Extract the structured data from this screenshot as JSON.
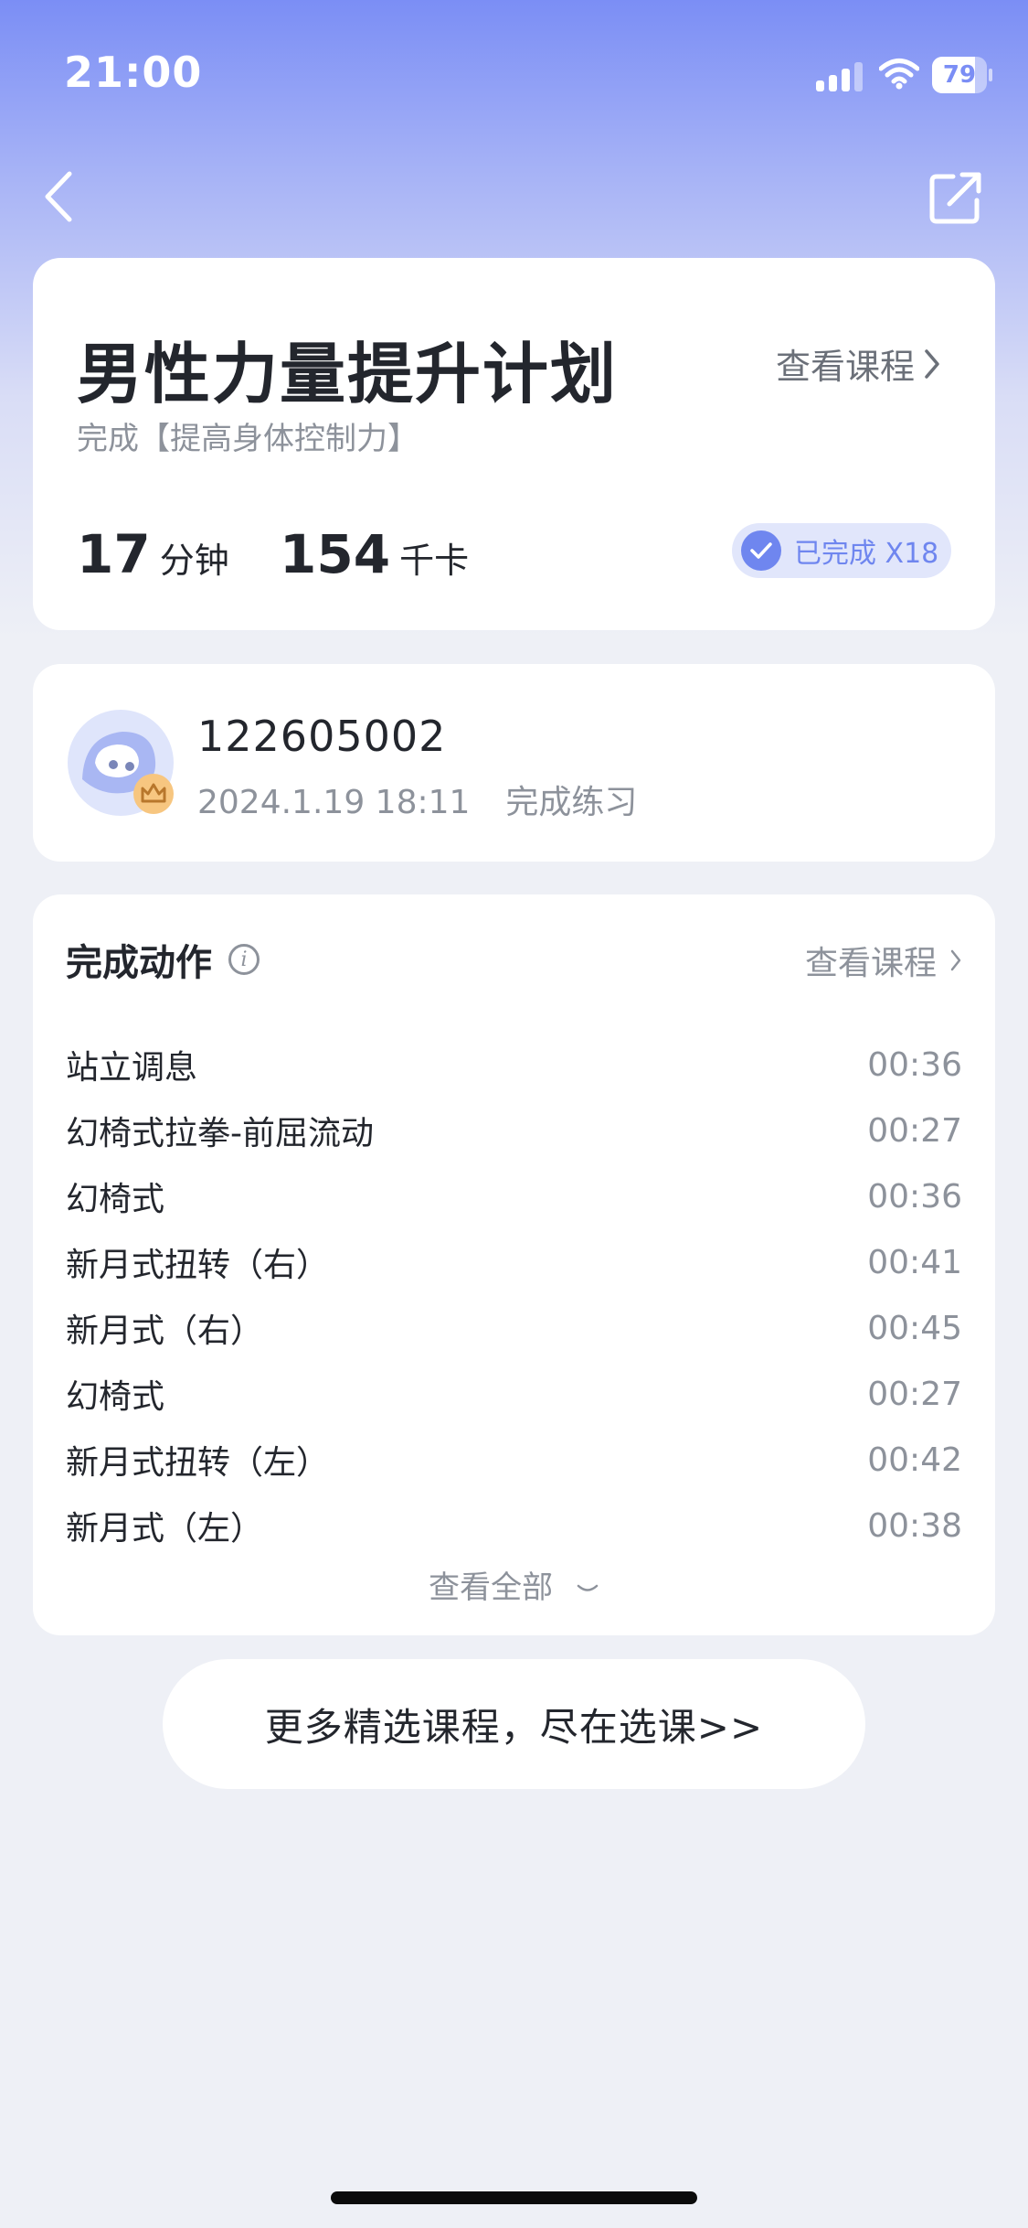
{
  "status_bar": {
    "time": "21:00",
    "battery": "79",
    "battery_level": 0.79,
    "icons": [
      "signal-icon",
      "wifi-icon",
      "battery-icon"
    ]
  },
  "nav": {
    "icons": [
      "back-arrow-icon",
      "share-icon"
    ]
  },
  "summary": {
    "title": "男性力量提升计划",
    "subtitle": "完成【提高身体控制力】",
    "view_course": "查看课程",
    "minutes_value": "17",
    "minutes_unit": "分钟",
    "kcal_value": "154",
    "kcal_unit": "千卡",
    "completed_badge": "已完成 X18"
  },
  "user": {
    "name": "122605002",
    "date": "2024.1.19 18:11",
    "record_label": "完成练习"
  },
  "actions": {
    "title": "完成动作",
    "view_course": "查看课程",
    "items": [
      {
        "name": "站立调息",
        "time": "00:36"
      },
      {
        "name": "幻椅式拉拳-前屈流动",
        "time": "00:27"
      },
      {
        "name": "幻椅式",
        "time": "00:36"
      },
      {
        "name": "新月式扭转（右）",
        "time": "00:41"
      },
      {
        "name": "新月式（右）",
        "time": "00:45"
      },
      {
        "name": "幻椅式",
        "time": "00:27"
      },
      {
        "name": "新月式扭转（左）",
        "time": "00:42"
      },
      {
        "name": "新月式（左）",
        "time": "00:38"
      }
    ],
    "view_all": "查看全部"
  },
  "cta": {
    "label": "更多精选课程，尽在选课>>"
  },
  "colors": {
    "accent": "#6f86ef",
    "gradient_top": "#7b8ef5",
    "background": "#eef0f6"
  }
}
